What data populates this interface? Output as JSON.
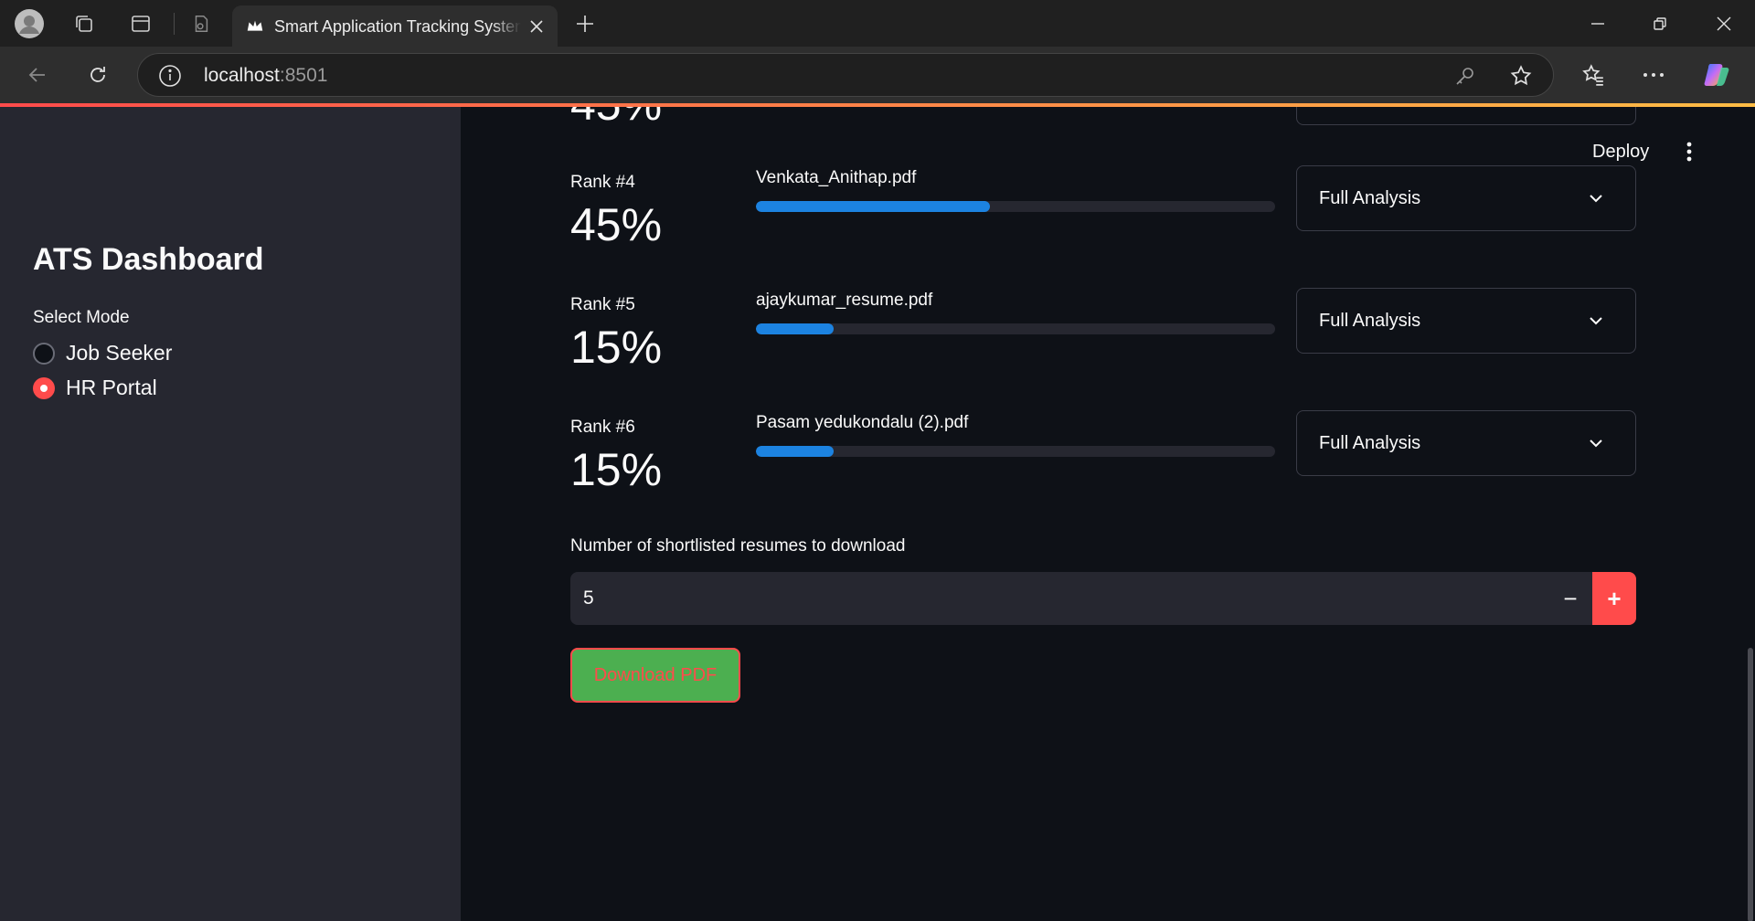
{
  "browser": {
    "tab_title": "Smart Application Tracking System",
    "url_host": "localhost",
    "url_port": ":8501"
  },
  "sidebar": {
    "title": "ATS Dashboard",
    "mode_label": "Select Mode",
    "modes": [
      {
        "label": "Job Seeker",
        "selected": false
      },
      {
        "label": "HR Portal",
        "selected": true
      }
    ]
  },
  "header": {
    "deploy_label": "Deploy"
  },
  "results": {
    "partial_score_top": "45%",
    "ranks": [
      {
        "rank": "Rank #4",
        "score": "45%",
        "file": "Venkata_Anithap.pdf",
        "progress": 0.45,
        "expander": "Full Analysis"
      },
      {
        "rank": "Rank #5",
        "score": "15%",
        "file": "ajaykumar_resume.pdf",
        "progress": 0.15,
        "expander": "Full Analysis"
      },
      {
        "rank": "Rank #6",
        "score": "15%",
        "file": "Pasam yedukondalu (2).pdf",
        "progress": 0.15,
        "expander": "Full Analysis"
      }
    ]
  },
  "download": {
    "count_label": "Number of shortlisted resumes to download",
    "count_value": "5",
    "minus": "−",
    "plus": "+",
    "button_label": "Download PDF"
  },
  "colors": {
    "accent": "#ff4b4b",
    "progress": "#1c83e1",
    "download_bg": "#4caf50"
  }
}
